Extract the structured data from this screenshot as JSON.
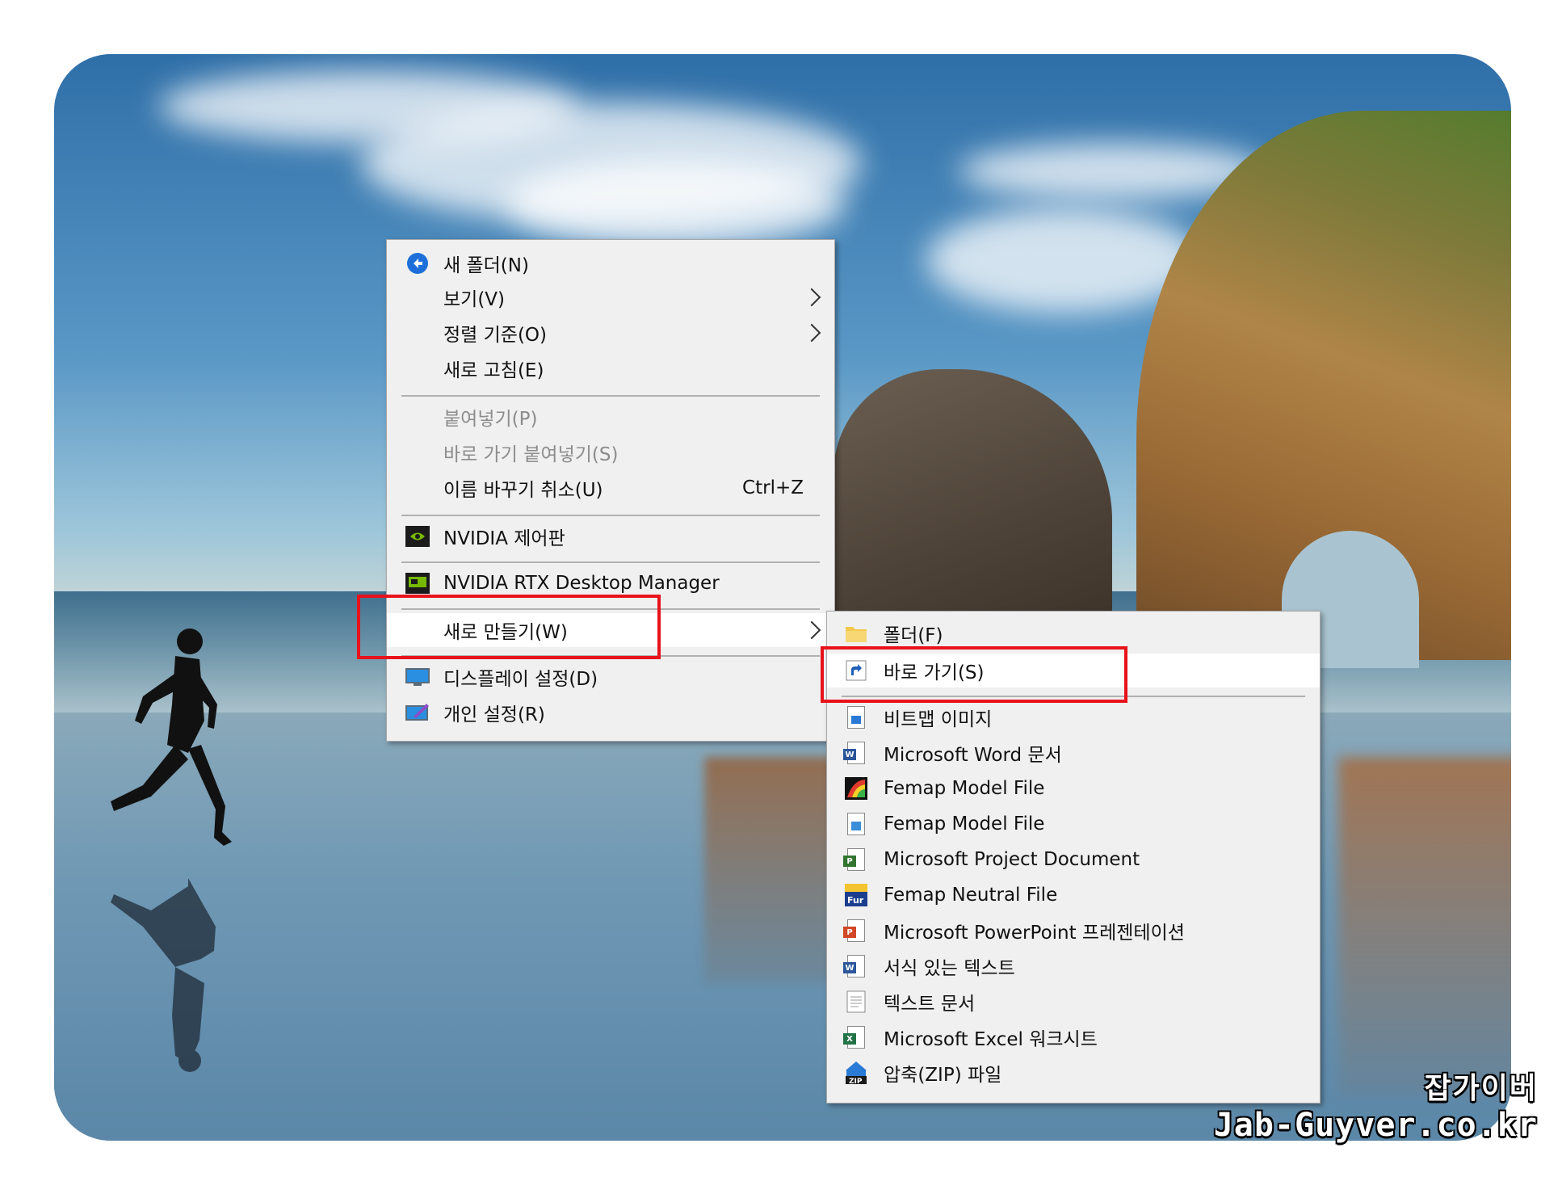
{
  "main_menu": {
    "items": [
      {
        "label": "새 폴더(N)"
      },
      {
        "label": "보기(V)"
      },
      {
        "label": "정렬 기준(O)"
      },
      {
        "label": "새로 고침(E)"
      },
      {
        "label": "붙여넣기(P)"
      },
      {
        "label": "바로 가기 붙여넣기(S)"
      },
      {
        "label": "이름 바꾸기 취소(U)",
        "shortcut": "Ctrl+Z"
      },
      {
        "label": "NVIDIA 제어판"
      },
      {
        "label": "NVIDIA RTX Desktop Manager"
      },
      {
        "label": "새로 만들기(W)"
      },
      {
        "label": "디스플레이 설정(D)"
      },
      {
        "label": "개인 설정(R)"
      }
    ]
  },
  "sub_menu": {
    "items": [
      {
        "label": "폴더(F)"
      },
      {
        "label": "바로 가기(S)"
      },
      {
        "label": "비트맵 이미지"
      },
      {
        "label": "Microsoft Word 문서"
      },
      {
        "label": "Femap Model File"
      },
      {
        "label": "Femap Model File"
      },
      {
        "label": "Microsoft Project Document"
      },
      {
        "label": "Femap Neutral File"
      },
      {
        "label": "Microsoft PowerPoint 프레젠테이션"
      },
      {
        "label": "서식 있는 텍스트"
      },
      {
        "label": "텍스트 문서"
      },
      {
        "label": "Microsoft Excel 워크시트"
      },
      {
        "label": "압축(ZIP) 파일"
      }
    ]
  },
  "watermark": {
    "line1": "잡가이버",
    "line2": "Jab-Guyver.co.kr"
  },
  "colors": {
    "highlight_box": "#e8121b",
    "menu_bg": "#f0f0f0",
    "hover_bg": "#ffffff"
  }
}
